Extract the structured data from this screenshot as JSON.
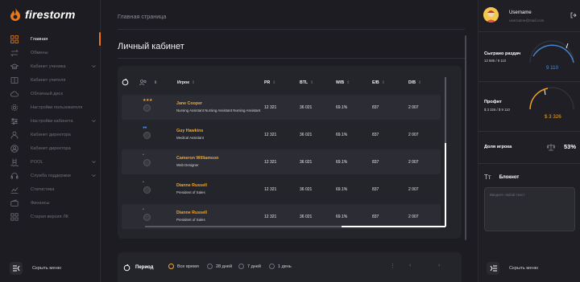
{
  "app": {
    "brand": "firestorm",
    "accent": "#e8781a",
    "gold": "#f5a623"
  },
  "sidebar": {
    "items": [
      {
        "label": "Главная",
        "icon": "grid-icon",
        "active": true,
        "chevron": false
      },
      {
        "label": "Обмены",
        "icon": "swap-icon",
        "active": false,
        "chevron": false
      },
      {
        "label": "Кабинет ученика",
        "icon": "graduation-cap-icon",
        "active": false,
        "chevron": true
      },
      {
        "label": "Кабинет учителя",
        "icon": "book-icon",
        "active": false,
        "chevron": false
      },
      {
        "label": "Облачный диск",
        "icon": "cloud-icon",
        "active": false,
        "chevron": false
      },
      {
        "label": "Настройки пользователя",
        "icon": "gear-icon",
        "active": false,
        "chevron": false
      },
      {
        "label": "Настройки кабинета",
        "icon": "settings-sliders-icon",
        "active": false,
        "chevron": true
      },
      {
        "label": "Кабинет директора",
        "icon": "user-icon",
        "active": false,
        "chevron": false
      },
      {
        "label": "Кабинет директора",
        "icon": "user-circle-icon",
        "active": false,
        "chevron": false
      },
      {
        "label": "POOL",
        "icon": "pool-icon",
        "active": false,
        "chevron": true
      },
      {
        "label": "Служба поддержки",
        "icon": "headset-icon",
        "active": false,
        "chevron": true
      },
      {
        "label": "Статистика",
        "icon": "chart-icon",
        "active": false,
        "chevron": false
      },
      {
        "label": "Финансы",
        "icon": "wallet-icon",
        "active": false,
        "chevron": false
      },
      {
        "label": "Старая версия ЛК",
        "icon": "apps-icon",
        "active": false,
        "chevron": false
      }
    ],
    "collapse_label": "Скрыть меню"
  },
  "main": {
    "breadcrumb": "Главная страница",
    "title": "Личный кабинет",
    "table": {
      "headers": {
        "player": "Игрок",
        "pr": "PR",
        "btl": "BTL",
        "wb": "W/B",
        "eb": "E/B",
        "db": "D/B"
      },
      "rows": [
        {
          "name": "Jane Cooper",
          "role": "Nursing Assistant Nursing Assistant Nursing Assistant",
          "badge": "★★★",
          "badge_color": "#f5a623",
          "pr": "12 321",
          "btl": "36 021",
          "wb": "69.1%",
          "eb": "837",
          "db": "2 007"
        },
        {
          "name": "Guy Hawkins",
          "role": "Medical Assistant",
          "badge": "●●",
          "badge_color": "#4a90e2",
          "pr": "12 321",
          "btl": "36 021",
          "wb": "69.1%",
          "eb": "837",
          "db": "2 007"
        },
        {
          "name": "Cameron Williamson",
          "role": "Web Designer",
          "badge": "•",
          "badge_color": "#8b8b94",
          "pr": "12 321",
          "btl": "36 021",
          "wb": "69.1%",
          "eb": "837",
          "db": "2 007"
        },
        {
          "name": "Dianne Russell",
          "role": "President of Sales",
          "badge": "•",
          "badge_color": "#8b8b94",
          "pr": "12 321",
          "btl": "36 021",
          "wb": "69.1%",
          "eb": "837",
          "db": "2 007"
        },
        {
          "name": "Dianne Russell",
          "role": "President of Sales",
          "badge": "•",
          "badge_color": "#8b8b94",
          "pr": "12 321",
          "btl": "36 021",
          "wb": "69.1%",
          "eb": "837",
          "db": "2 007"
        }
      ]
    },
    "period": {
      "label": "Период",
      "options": [
        "Все время",
        "28 дней",
        "7 дней",
        "1 день"
      ],
      "selected": "Все время",
      "pager": {
        "more": "⋮",
        "prev": "‹",
        "next": "›"
      }
    }
  },
  "right": {
    "user": {
      "name": "Username",
      "email": "username@mail.com"
    },
    "played": {
      "title": "Сыграно раздач",
      "sub": "13 585 / 9 110",
      "value": "9 110",
      "color": "#4a90e2"
    },
    "profit": {
      "title": "Профит",
      "sub": "$ 3 326 / $ 9 110",
      "value": "$ 3 326",
      "color": "#f5a623"
    },
    "share": {
      "title": "Доля игрока",
      "value": "53%"
    },
    "notebook": {
      "icon_label": "Tт",
      "title": "Блокнот",
      "placeholder": "Введите любой текст"
    },
    "collapse_label": "Скрыть меню"
  }
}
